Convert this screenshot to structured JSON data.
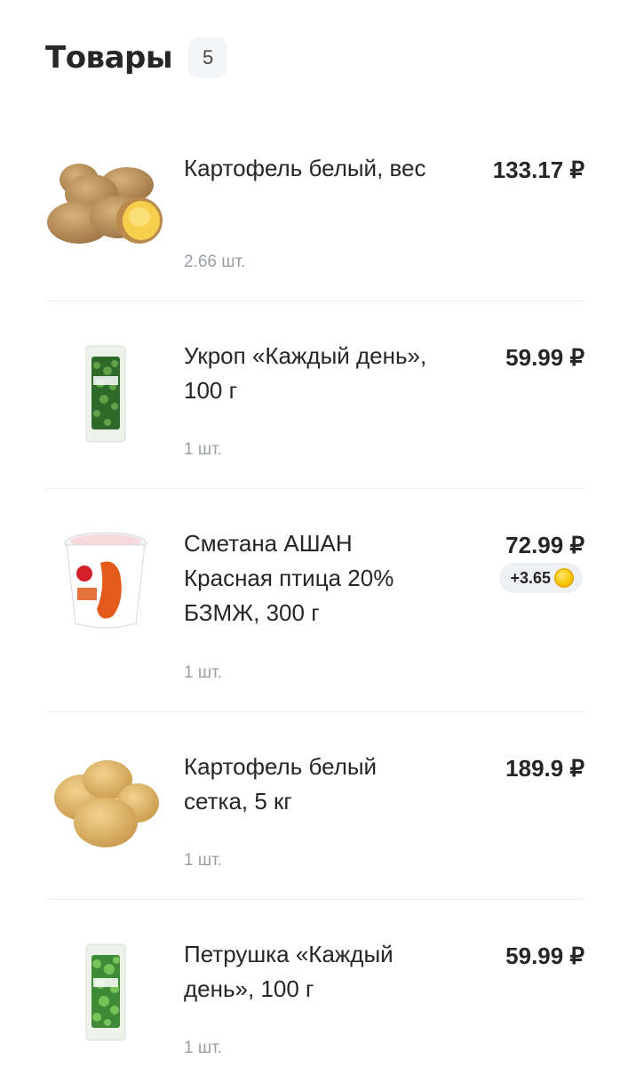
{
  "header": {
    "title": "Товары",
    "count": "5"
  },
  "items": [
    {
      "name": "Картофель белый, вес",
      "qty": "2.66 шт.",
      "price": "133.17 ₽",
      "image": "potatoes-image"
    },
    {
      "name": "Укроп «Каждый день», 100 г",
      "qty": "1 шт.",
      "price": "59.99 ₽",
      "image": "dill-pack-image"
    },
    {
      "name": "Сметана АШАН Красная птица 20% БЗМЖ, 300 г",
      "qty": "1 шт.",
      "price": "72.99 ₽",
      "bonus": "+3.65",
      "bonus_icon": "coin-icon",
      "image": "sour-cream-cup-image"
    },
    {
      "name": "Картофель белый сетка, 5 кг",
      "qty": "1 шт.",
      "price": "189.9 ₽",
      "image": "potatoes-net-image"
    },
    {
      "name": "Петрушка «Каждый день», 100 г",
      "qty": "1 шт.",
      "price": "59.99 ₽",
      "image": "parsley-pack-image"
    }
  ],
  "colors": {
    "text": "#262626",
    "muted": "#9a9ea3",
    "divider": "#ececec",
    "badge_bg": "#eef0f4"
  }
}
